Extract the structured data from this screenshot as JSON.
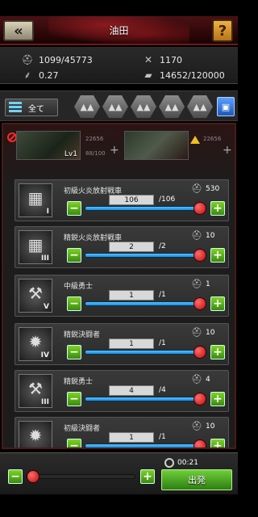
{
  "header": {
    "title": "油田",
    "back_icon": "double-chevron-left-icon",
    "help_label": "?"
  },
  "stats": {
    "troops": "1099/45773",
    "upkeep": "0.27",
    "power": "1170",
    "load": "14652/120000"
  },
  "filter": {
    "all_label": "全て"
  },
  "heroes": {
    "slot1": {
      "level": "Lv1",
      "meta1": "22656",
      "meta2": "88/100"
    },
    "slot2": {
      "meta1": "22656"
    }
  },
  "units": [
    {
      "name": "初級火炎放射戦車",
      "rank": "I",
      "available": "530",
      "selected": "106",
      "max": "/106",
      "glyph": "tank-icon"
    },
    {
      "name": "精鋭火炎放射戦車",
      "rank": "III",
      "available": "10",
      "selected": "2",
      "max": "/2",
      "glyph": "tank-icon"
    },
    {
      "name": "中級勇士",
      "rank": "V",
      "available": "1",
      "selected": "1",
      "max": "/1",
      "glyph": "axe-icon"
    },
    {
      "name": "精鋭決闘者",
      "rank": "IV",
      "available": "10",
      "selected": "1",
      "max": "/1",
      "glyph": "mace-icon"
    },
    {
      "name": "精鋭勇士",
      "rank": "III",
      "available": "4",
      "selected": "4",
      "max": "/4",
      "glyph": "axe-icon"
    },
    {
      "name": "初級決闘者",
      "rank": "",
      "available": "10",
      "selected": "1",
      "max": "/1",
      "glyph": "mace-icon"
    }
  ],
  "footer": {
    "timer": "00:21",
    "march_label": "出発"
  }
}
